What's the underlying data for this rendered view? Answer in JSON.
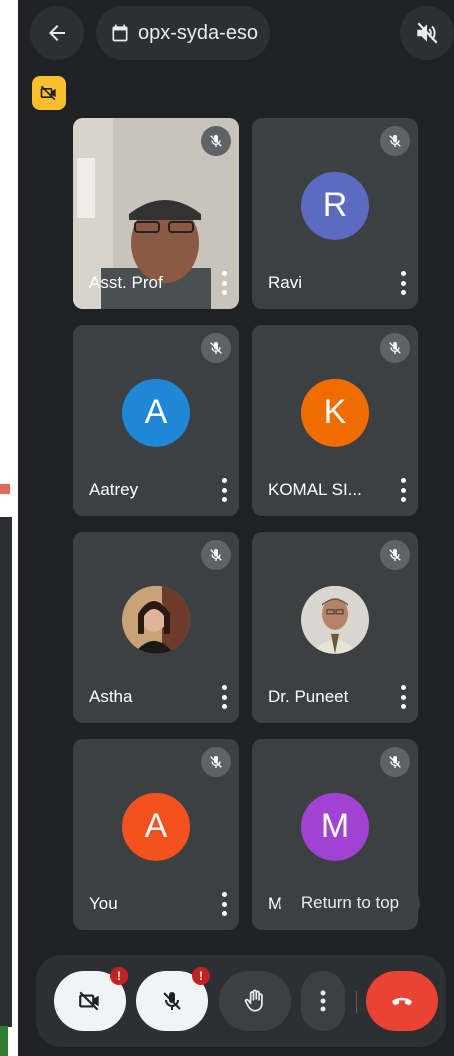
{
  "meeting": {
    "code": "opx-syda-eso"
  },
  "colors": {
    "background": "#202124",
    "tile": "#3c4043",
    "end_call": "#ea4335",
    "camera_badge": "#f9bf2c"
  },
  "participants": [
    {
      "name": "Asst. Prof",
      "type": "video"
    },
    {
      "name": "Ravi",
      "initial": "R",
      "color": "#5c6bc0"
    },
    {
      "name": "Aatrey",
      "initial": "A",
      "color": "#1e88d6"
    },
    {
      "name": "KOMAL SI...",
      "initial": "K",
      "color": "#ef6c00"
    },
    {
      "name": "Astha",
      "type": "photo"
    },
    {
      "name": "Dr. Puneet",
      "type": "photo"
    },
    {
      "name": "You",
      "initial": "A",
      "color": "#f4511e"
    },
    {
      "name": "Ms.",
      "initial": "M",
      "color": "#a142d4"
    }
  ],
  "return_to_top": "Return to top",
  "controls": {
    "camera_alert": "!",
    "mic_alert": "!"
  }
}
